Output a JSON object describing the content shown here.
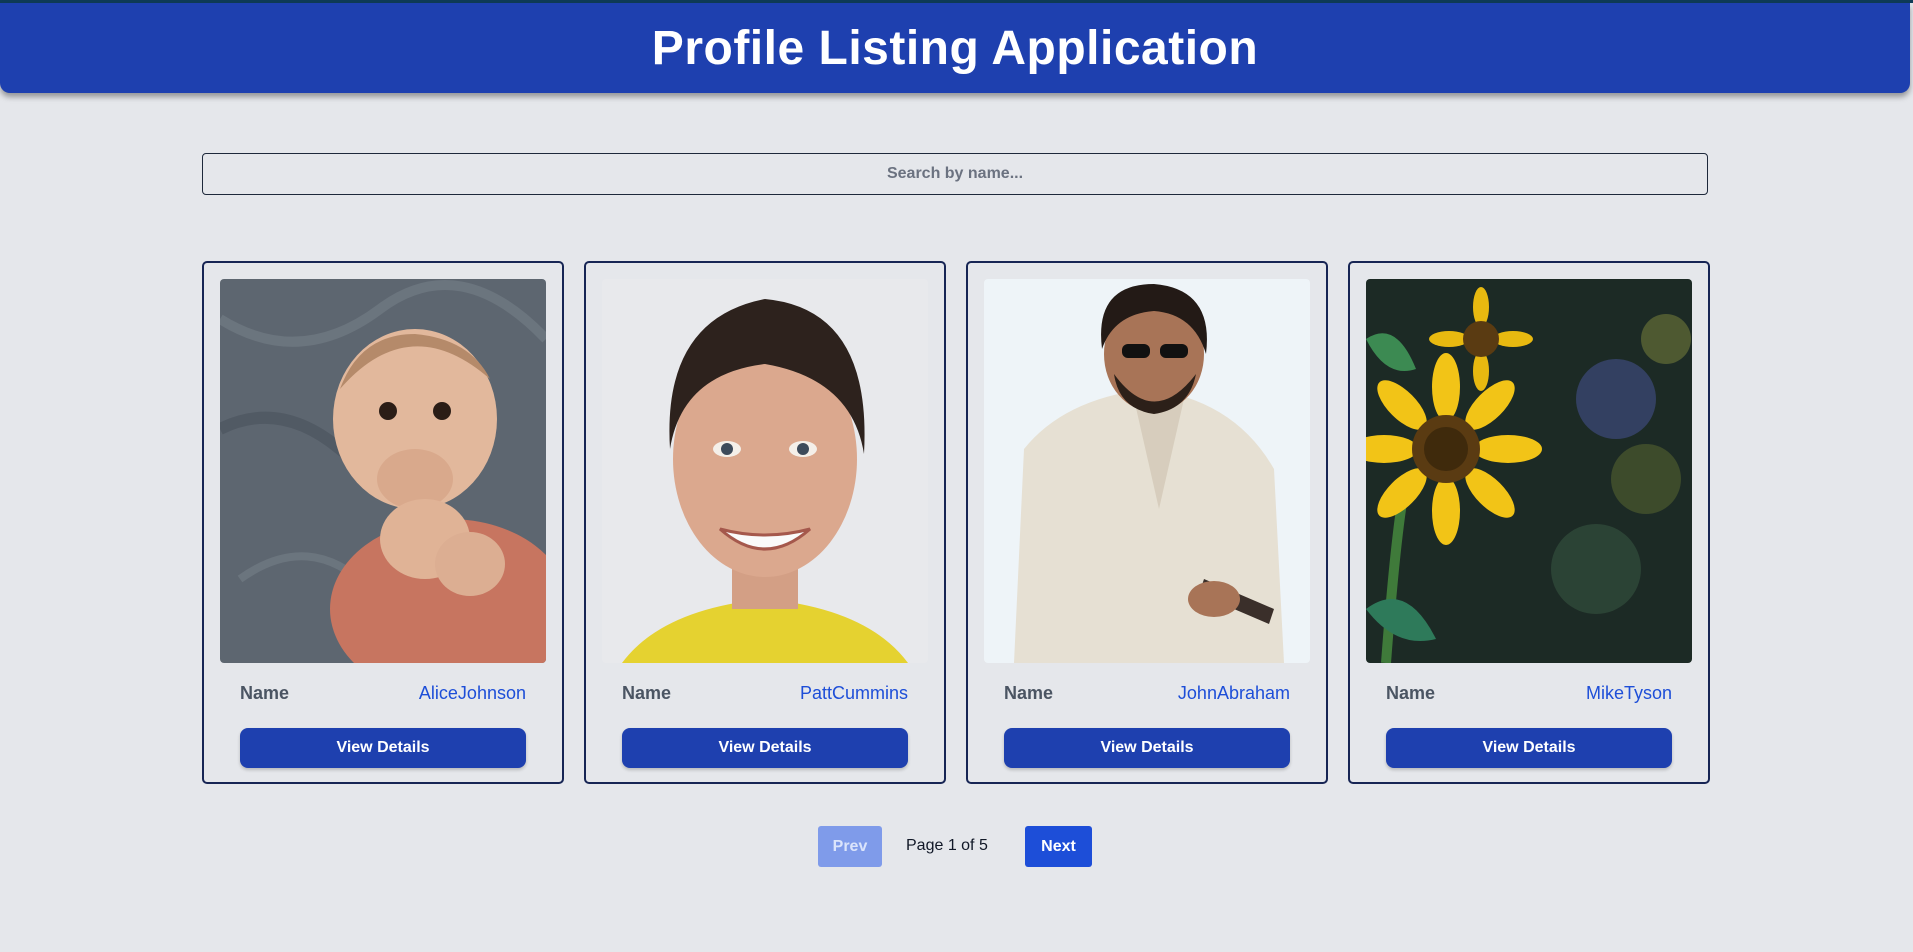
{
  "app": {
    "title": "Profile Listing Application"
  },
  "search": {
    "placeholder": "Search by name..."
  },
  "profiles": [
    {
      "name_label": "Name",
      "name": "AliceJohnson",
      "button_label": "View Details",
      "image": "baby-photo"
    },
    {
      "name_label": "Name",
      "name": "PattCummins",
      "button_label": "View Details",
      "image": "man-portrait-photo"
    },
    {
      "name_label": "Name",
      "name": "JohnAbraham",
      "button_label": "View Details",
      "image": "man-white-shirt-photo"
    },
    {
      "name_label": "Name",
      "name": "MikeTyson",
      "button_label": "View Details",
      "image": "sunflower-photo"
    }
  ],
  "pagination": {
    "prev_label": "Prev",
    "next_label": "Next",
    "page_text": "Page 1 of 5",
    "current_page": 1,
    "total_pages": 5
  },
  "colors": {
    "header_bg": "#1e40af",
    "button_bg": "#1e40af",
    "accent_text": "#1d4ed8",
    "page_bg": "#e5e7eb"
  }
}
